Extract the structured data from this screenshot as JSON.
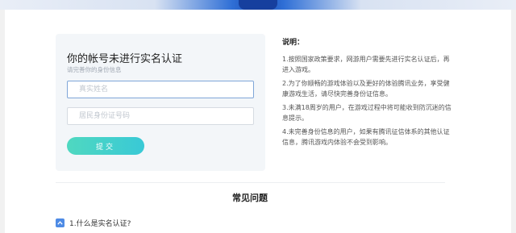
{
  "banner": {
    "accent_color": "#1b4db3"
  },
  "form": {
    "title": "你的帐号未进行实名认证",
    "subtitle": "请完善你的身份信息",
    "name_placeholder": "真实姓名",
    "id_placeholder": "居民身份证号码",
    "submit_label": "提交",
    "submit_color": "#4fd8c0"
  },
  "notes": {
    "title": "说明：",
    "items": [
      "1.按照国家政策要求，网游用户需要先进行实名认证后，再进入游戏。",
      "2.为了你顺畅的游戏体验以及更好的体验腾讯业务，享受健康游戏生活，请尽快完善身份证信息。",
      "3.未满18周岁的用户，在游戏过程中将可能收到防沉迷的信息提示。",
      "4.未完善身份信息的用户，如果有腾讯征信体系的其他认证信息，腾讯游戏内体验不会受到影响。"
    ]
  },
  "faq": {
    "title": "常见问题",
    "items": [
      {
        "question": "1.什么是实名认证?",
        "icon": "chevron-up-icon"
      }
    ]
  }
}
